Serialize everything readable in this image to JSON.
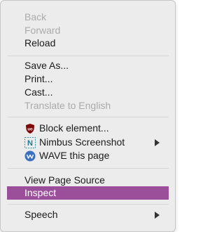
{
  "menu": {
    "back": "Back",
    "forward": "Forward",
    "reload": "Reload",
    "save_as": "Save As...",
    "print": "Print...",
    "cast": "Cast...",
    "translate": "Translate to English",
    "block_element": "Block element...",
    "nimbus": "Nimbus Screenshot",
    "wave": "WAVE this page",
    "view_source": "View Page Source",
    "inspect": "Inspect",
    "speech": "Speech"
  },
  "colors": {
    "highlight": "#9b4f9a",
    "disabled_text": "#ababab",
    "menu_bg": "#ececec"
  },
  "icons": {
    "block_element": "ublock-shield-icon",
    "nimbus": "nimbus-n-icon",
    "wave": "wave-icon",
    "submenu": "chevron-right-icon"
  }
}
